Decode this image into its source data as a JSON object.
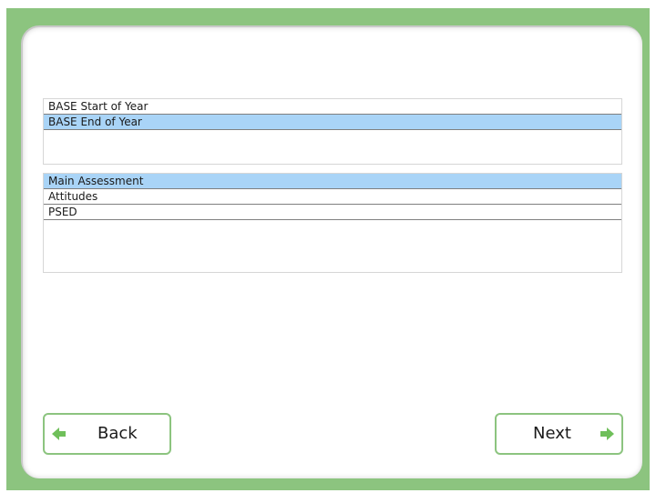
{
  "colors": {
    "frame": "#8cc47f",
    "selected_row": "#a9d4f7",
    "arrow": "#6fbf5a"
  },
  "assessment_periods": {
    "items": [
      {
        "label": "BASE Start of Year",
        "selected": false
      },
      {
        "label": "BASE End of Year",
        "selected": true
      }
    ]
  },
  "assessment_types": {
    "items": [
      {
        "label": "Main Assessment",
        "selected": true
      },
      {
        "label": "Attitudes",
        "selected": false
      },
      {
        "label": "PSED",
        "selected": false
      }
    ]
  },
  "nav": {
    "back_label": "Back",
    "back_icon": "arrow-left-icon",
    "next_label": "Next",
    "next_icon": "arrow-right-icon"
  }
}
